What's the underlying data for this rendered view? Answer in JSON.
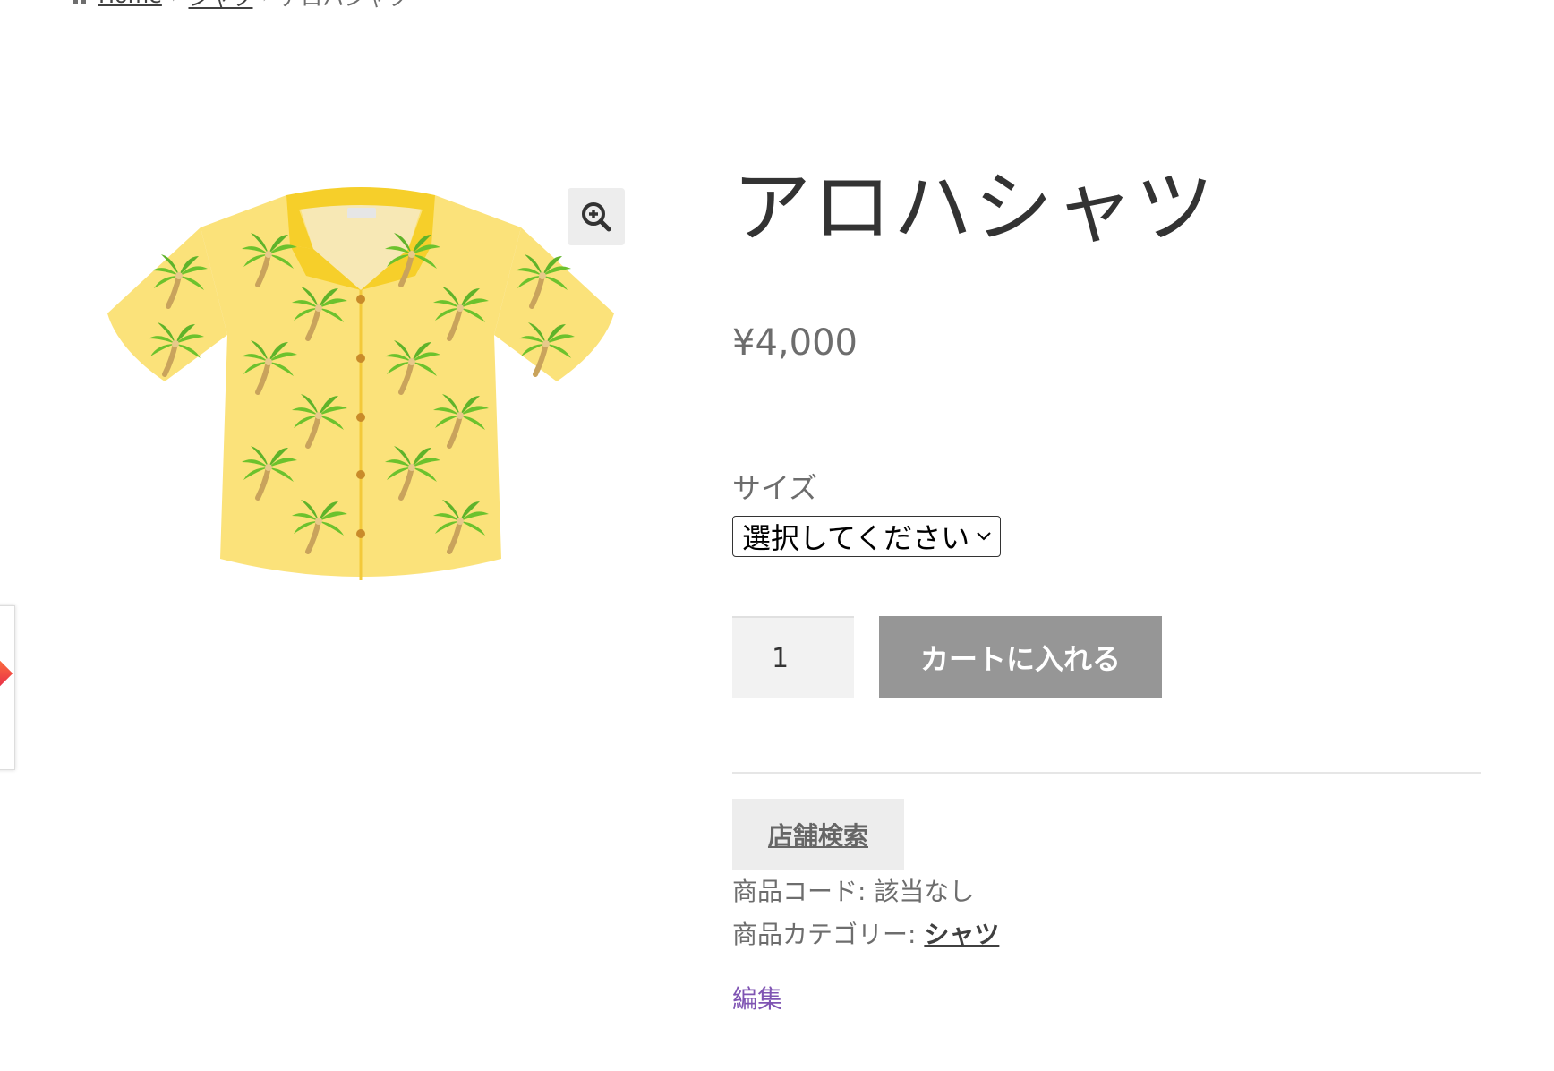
{
  "breadcrumb": {
    "home_label": "Home",
    "category_label": "シャツ",
    "current_label": "アロハシャツ",
    "separator": "›"
  },
  "product": {
    "title": "アロハシャツ",
    "price": "¥4,000",
    "image_icon": "aloha-shirt-image"
  },
  "variation": {
    "label": "サイズ",
    "selected": "選択してください"
  },
  "cart": {
    "quantity": "1",
    "add_label": "カートに入れる"
  },
  "store_search": {
    "label": "店舗検索"
  },
  "meta": {
    "sku_label": "商品コード:",
    "sku_value": "該当なし",
    "category_label": "商品カテゴリー:",
    "category_value": "シャツ"
  },
  "edit": {
    "label": "編集"
  },
  "colors": {
    "shirt": "#fbe27a",
    "collar": "#f6cf2a",
    "palm_leaf": "#6cc22d",
    "palm_trunk": "#c9a35c",
    "button": "#c98b2a",
    "cart_button": "#969696",
    "edit_link": "#7f54b3"
  }
}
